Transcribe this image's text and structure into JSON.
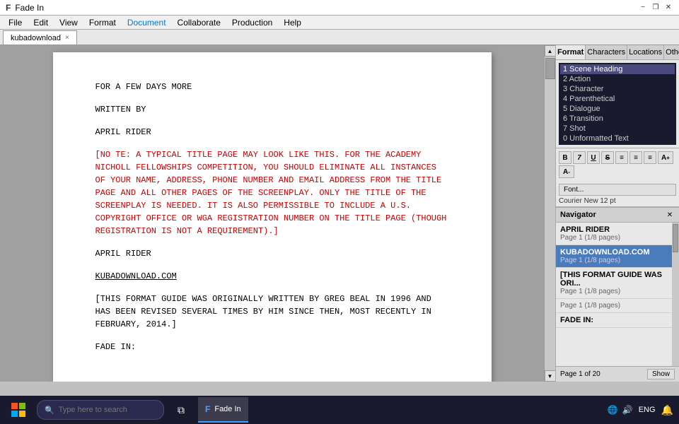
{
  "titleBar": {
    "appIcon": "F",
    "title": "Fade In",
    "minimizeLabel": "−",
    "maximizeLabel": "❐",
    "closeLabel": "✕"
  },
  "menuBar": {
    "items": [
      {
        "label": "File",
        "active": false
      },
      {
        "label": "Edit",
        "active": false
      },
      {
        "label": "View",
        "active": false
      },
      {
        "label": "Format",
        "active": false
      },
      {
        "label": "Document",
        "active": true
      },
      {
        "label": "Collaborate",
        "active": false
      },
      {
        "label": "Production",
        "active": false
      },
      {
        "label": "Help",
        "active": false
      }
    ]
  },
  "tabBar": {
    "tabs": [
      {
        "label": "kubadownload",
        "active": true,
        "closeBtn": "×"
      }
    ]
  },
  "editor": {
    "pageContent": [
      {
        "id": "line1",
        "text": "FOR A FEW DAYS MORE",
        "style": "normal"
      },
      {
        "id": "line2",
        "text": "WRITTEN BY",
        "style": "normal"
      },
      {
        "id": "line3",
        "text": "APRIL RIDER",
        "style": "normal"
      },
      {
        "id": "line4",
        "text": "[NO TE: A TYPICAL TITLE PAGE MAY LOOK LIKE THIS. FOR THE ACADEMY NICHOLL FELLOWSHIPS COMPETITION, YOU SHOULD ELIMINATE ALL INSTANCES OF YOUR NAME, ADDRESS, PHONE NUMBER AND EMAIL ADDRESS FROM THE TITLE PAGE AND ALL OTHER PAGES OF THE SCREENPLAY. ONLY THE TITLE OF THE SCREENPLAY IS NEEDED. IT IS ALSO PERMISSIBLE TO INCLUDE A U.S. COPYRIGHT OFFICE OR WGA REGISTRATION NUMBER ON THE TITLE PAGE (THOUGH REGISTRATION IS NOT A REQUIREMENT).]",
        "style": "red"
      },
      {
        "id": "line5",
        "text": "APRIL RIDER",
        "style": "normal"
      },
      {
        "id": "line6",
        "text": "KUBADOWNLOAD.COM",
        "style": "underline"
      },
      {
        "id": "line7",
        "text": "[THIS FORMAT GUIDE WAS ORIGINALLY WRITTEN BY GREG BEAL IN 1996 AND HAS BEEN REVISED SEVERAL TIMES BY HIM SINCE THEN, MOST RECENTLY IN FEBRUARY, 2014.]",
        "style": "normal"
      },
      {
        "id": "line8",
        "text": "FADE IN:",
        "style": "normal"
      }
    ]
  },
  "rightPanel": {
    "tabs": [
      {
        "label": "Format",
        "active": true
      },
      {
        "label": "Characters",
        "active": false
      },
      {
        "label": "Locations",
        "active": false
      },
      {
        "label": "Other",
        "active": false
      }
    ],
    "styles": [
      {
        "num": "1",
        "label": "Scene Heading",
        "selected": true
      },
      {
        "num": "2",
        "label": "Action",
        "selected": false
      },
      {
        "num": "3",
        "label": "Character",
        "selected": false
      },
      {
        "num": "4",
        "label": "Parenthetical",
        "selected": false
      },
      {
        "num": "5",
        "label": "Dialogue",
        "selected": false
      },
      {
        "num": "6",
        "label": "Transition",
        "selected": false
      },
      {
        "num": "7",
        "label": "Shot",
        "selected": false
      },
      {
        "num": "0",
        "label": "Unformatted Text",
        "selected": false
      }
    ],
    "formatButtons": [
      {
        "label": "B",
        "name": "bold"
      },
      {
        "label": "I",
        "name": "italic"
      },
      {
        "label": "U",
        "name": "underline"
      },
      {
        "label": "S",
        "name": "strikethrough"
      },
      {
        "label": "≡",
        "name": "align-left"
      },
      {
        "label": "≡",
        "name": "align-center"
      },
      {
        "label": "≡",
        "name": "align-right"
      },
      {
        "label": "A+",
        "name": "font-size-up"
      },
      {
        "label": "A−",
        "name": "font-size-down"
      }
    ],
    "fontButton": "Font...",
    "fontName": "Courier New 12 pt",
    "navigator": {
      "title": "Navigator",
      "items": [
        {
          "title": "APRIL RIDER",
          "sub": "Page 1 (1/8 pages)",
          "active": false
        },
        {
          "title": "KUBADOWNLOAD.COM",
          "sub": "Page 1 (1/8 pages)",
          "active": true
        },
        {
          "title": "[THIS FORMAT GUIDE WAS ORI...",
          "sub": "Page 1 (1/8 pages)",
          "active": false
        },
        {
          "title": "",
          "sub": "Page 1 (1/8 pages)",
          "active": false
        }
      ],
      "footer": {
        "pageInfo": "Page 1 of 20",
        "showBtn": "Show"
      },
      "fadein": "FADE IN:"
    }
  },
  "taskbar": {
    "searchPlaceholder": "Type here to search",
    "appLabel": "Fade In",
    "sysLocale": "ENG",
    "time": ""
  }
}
